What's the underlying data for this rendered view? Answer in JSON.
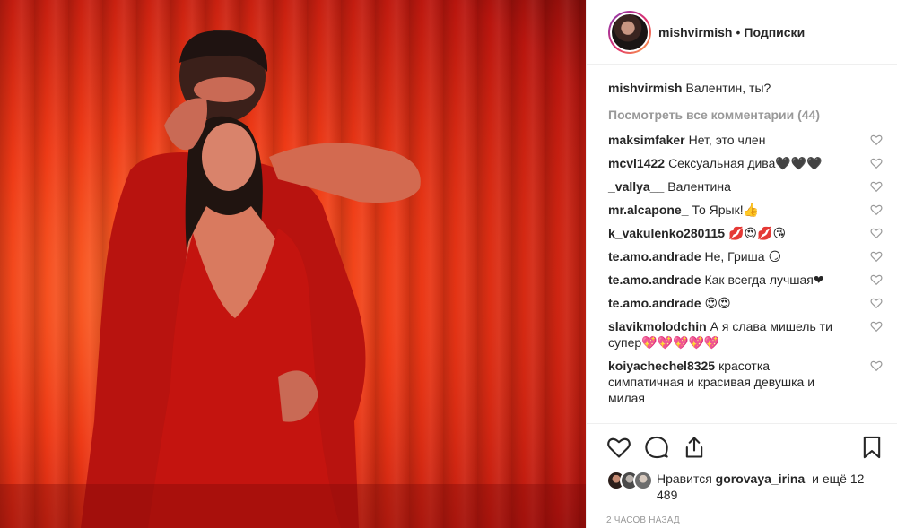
{
  "post": {
    "username": "mishvirmish",
    "separator": "•",
    "follow_label": "Подписки"
  },
  "caption": {
    "user": "mishvirmish",
    "text": "Валентин, ты?"
  },
  "view_all": "Посмотреть все комментарии (44)",
  "comments": [
    {
      "user": "maksimfaker",
      "text": "Нет, это член"
    },
    {
      "user": "mcvl1422",
      "text": "Сексуальная дива🖤🖤🖤"
    },
    {
      "user": "_vallya__",
      "text": "Валентина"
    },
    {
      "user": "mr.alcapone_",
      "text": "То Ярык!👍"
    },
    {
      "user": "k_vakulenko280115",
      "text": "💋😍💋😘"
    },
    {
      "user": "te.amo.andrade",
      "text": "Не, Гриша 😏"
    },
    {
      "user": "te.amo.andrade",
      "text": "Как всегда лучшая❤"
    },
    {
      "user": "te.amo.andrade",
      "text": "😍😍"
    },
    {
      "user": "slavikmolodchin",
      "text": "А я слава мишель ти супер💖💖💖💖💖"
    },
    {
      "user": "koiyachechel8325",
      "text": "красотка симпатичная и красивая девушка и милая"
    }
  ],
  "likes": {
    "prefix": "Нравится",
    "user": "gorovaya_irina",
    "suffix": "и ещё 12 489"
  },
  "timestamp": "2 часов назад",
  "colors": {
    "accent": "#e1306c",
    "muted": "#999999"
  },
  "icons": [
    "heart-icon",
    "comment-icon",
    "share-icon",
    "bookmark-icon"
  ]
}
